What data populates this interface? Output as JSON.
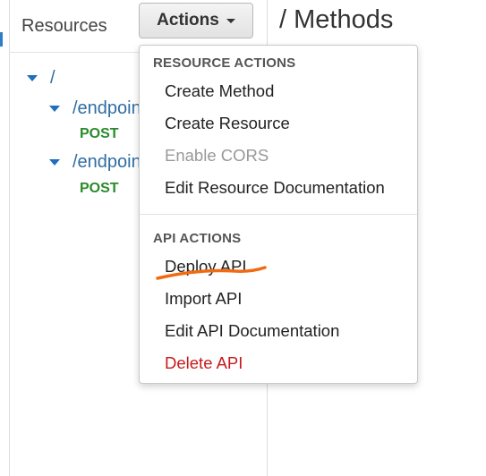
{
  "resources": {
    "title": "Resources"
  },
  "toolbar": {
    "actions_label": "Actions"
  },
  "methods_panel": {
    "title": "/ Methods"
  },
  "tree": {
    "root": "/",
    "items": [
      {
        "path": "/endpoin",
        "method": "POST"
      },
      {
        "path": "/endpoin",
        "method": "POST"
      }
    ]
  },
  "menu": {
    "resource_actions_header": "RESOURCE ACTIONS",
    "resource_items": [
      {
        "label": "Create Method"
      },
      {
        "label": "Create Resource"
      },
      {
        "label": "Enable CORS"
      },
      {
        "label": "Edit Resource Documentation"
      }
    ],
    "api_actions_header": "API ACTIONS",
    "api_items": [
      {
        "label": "Deploy API"
      },
      {
        "label": "Import API"
      },
      {
        "label": "Edit API Documentation"
      },
      {
        "label": "Delete API"
      }
    ]
  },
  "colors": {
    "link": "#2e6da4",
    "post_method": "#2a8a2a",
    "danger": "#c71a1a",
    "annotation": "#f26a10"
  }
}
